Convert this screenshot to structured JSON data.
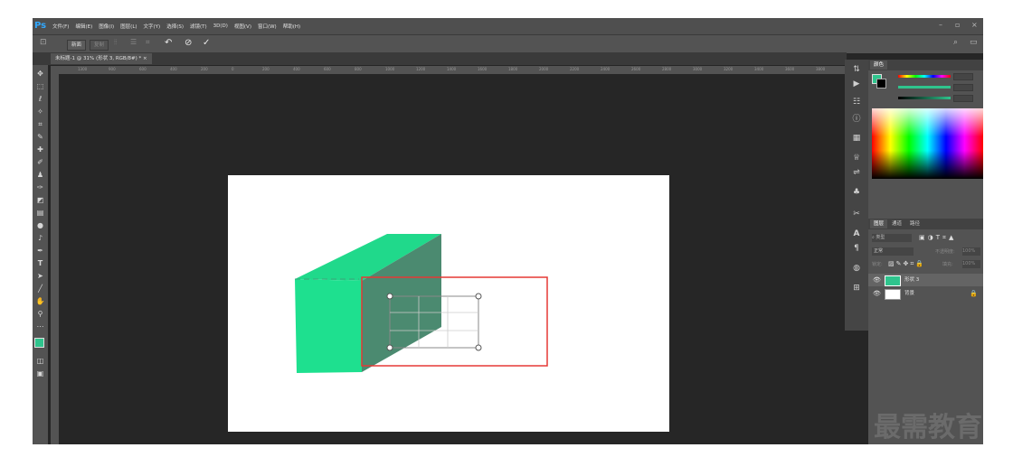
{
  "app": {
    "logo": "Ps"
  },
  "menu": [
    "文件(F)",
    "编辑(E)",
    "图像(I)",
    "图层(L)",
    "文字(Y)",
    "选择(S)",
    "滤镜(T)",
    "3D(D)",
    "视图(V)",
    "窗口(W)",
    "帮助(H)"
  ],
  "options": {
    "new_label": "新面",
    "copy_label": "复制"
  },
  "document": {
    "tab_title": "未标题-1 @ 31% (形状 3, RGB/8#) *"
  },
  "ruler_ticks": [
    "1300",
    "900",
    "600",
    "400",
    "200",
    "0",
    "200",
    "400",
    "600",
    "800",
    "1000",
    "1200",
    "1400",
    "1600",
    "1800",
    "2000",
    "2200",
    "2400",
    "2600",
    "2800",
    "3000",
    "3200",
    "3400",
    "3600",
    "3800"
  ],
  "panels": {
    "color_tab": "颜色",
    "slider_values": [
      "255",
      "255",
      "255"
    ],
    "layers_tabs": [
      "图层",
      "通道",
      "路径"
    ],
    "kind_label": "类型",
    "blend_mode": "正常",
    "opacity_label": "不透明度:",
    "opacity_value": "100%",
    "lock_label": "锁定:",
    "fill_label": "填充:",
    "fill_value": "100%",
    "layers": [
      {
        "name": "形状 3"
      },
      {
        "name": "背景"
      }
    ]
  },
  "colors": {
    "shape_front": "#1ee08f",
    "shape_top": "#20d98b",
    "shape_side": "#4a8a70",
    "highlight": "#e53935",
    "accent": "#31a8ff"
  },
  "watermark": "最需教育"
}
